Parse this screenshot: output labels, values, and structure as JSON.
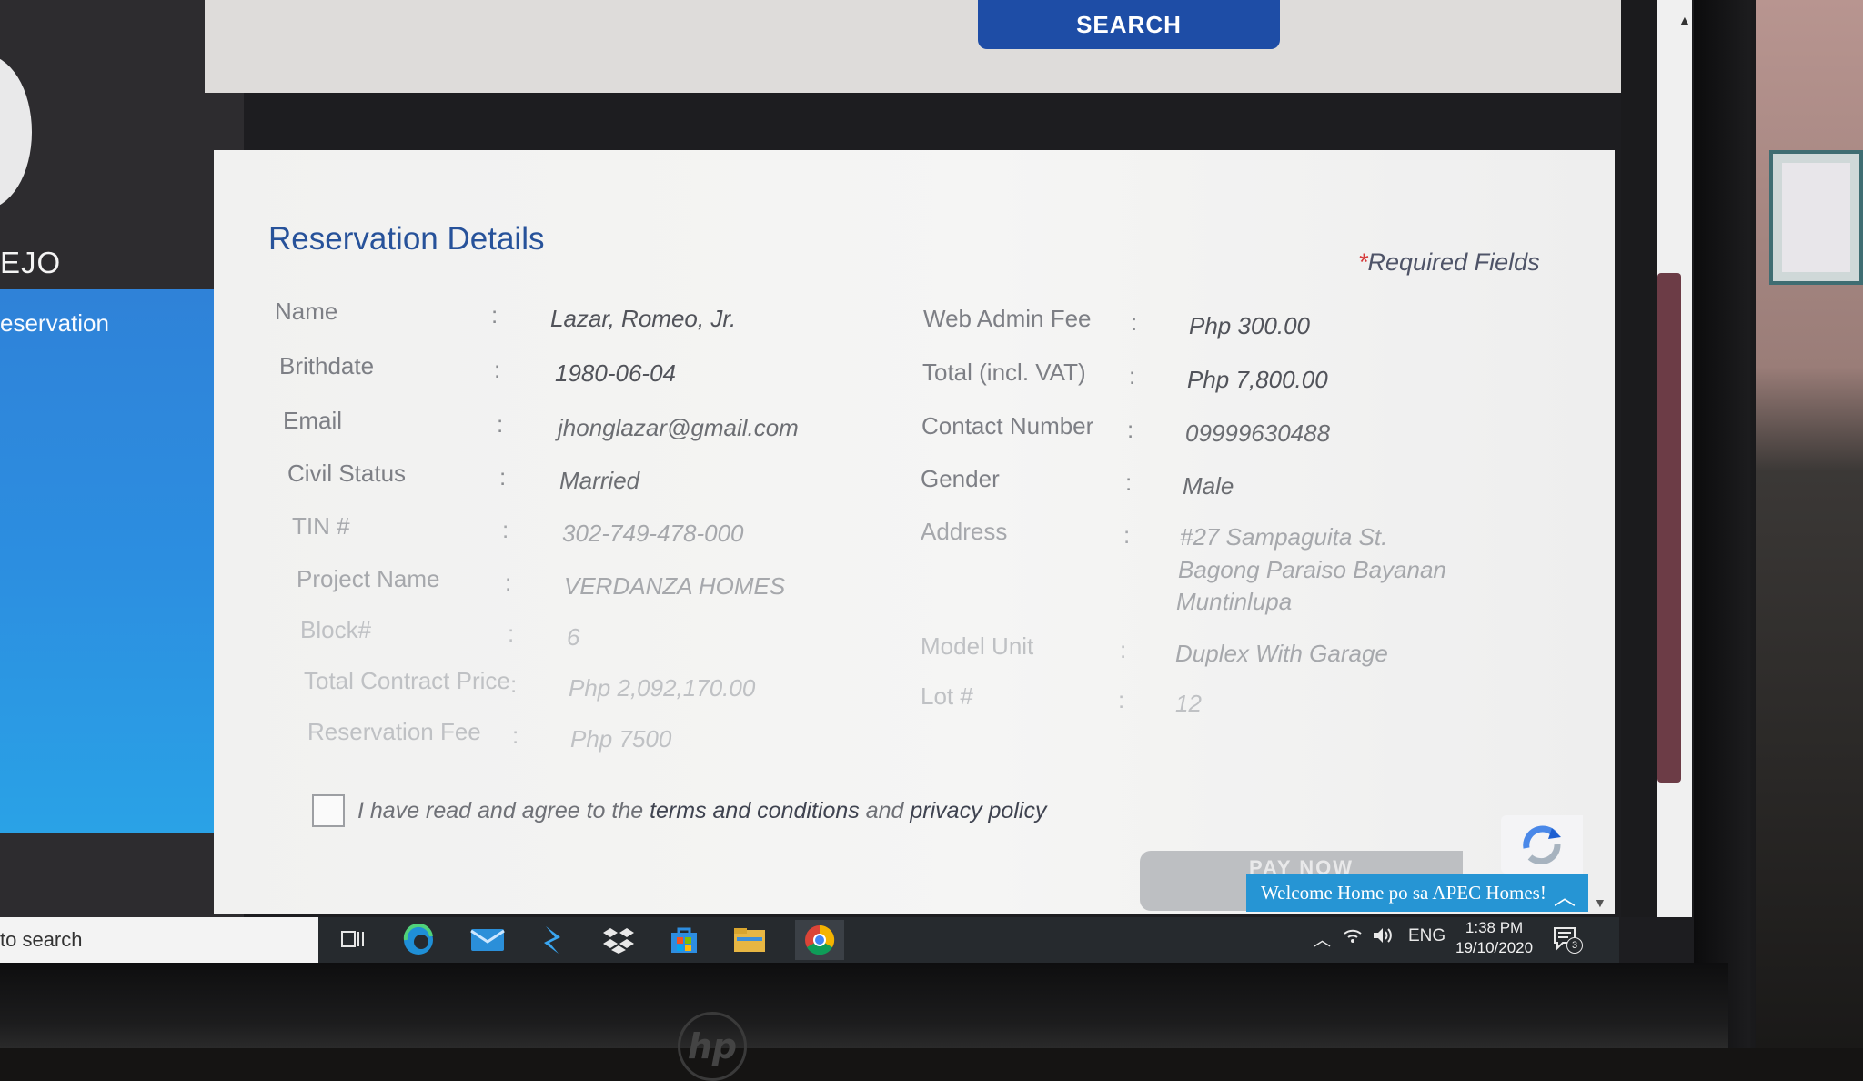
{
  "sidebar": {
    "user_name": "EJO",
    "nav_active_label": "eservation"
  },
  "header": {
    "search_label": "SEARCH"
  },
  "form": {
    "title": "Reservation Details",
    "required_star": "*",
    "required_text": "Required Fields",
    "left_fields": [
      {
        "label": "Name",
        "value": "Lazar, Romeo, Jr."
      },
      {
        "label": "Brithdate",
        "value": "1980-06-04"
      },
      {
        "label": "Email",
        "value": "jhonglazar@gmail.com"
      },
      {
        "label": "Civil Status",
        "value": "Married"
      },
      {
        "label": "TIN #",
        "value": "302-749-478-000"
      },
      {
        "label": "Project Name",
        "value": "VERDANZA HOMES"
      },
      {
        "label": "Block#",
        "value": "6"
      },
      {
        "label": "Total Contract Price",
        "value": "Php 2,092,170.00"
      },
      {
        "label": "Reservation Fee",
        "value": "Php 7500"
      }
    ],
    "right_fields": [
      {
        "label": "Web Admin Fee",
        "value": "Php 300.00"
      },
      {
        "label": "Total (incl. VAT)",
        "value": "Php 7,800.00"
      },
      {
        "label": "Contact Number",
        "value": "09999630488"
      },
      {
        "label": "Gender",
        "value": "Male"
      },
      {
        "label": "Address",
        "value_lines": [
          "#27 Sampaguita St.",
          "Bagong Paraiso Bayanan",
          "Muntinlupa"
        ]
      },
      {
        "label": "Model Unit",
        "value": "Duplex With Garage"
      },
      {
        "label": "Lot #",
        "value": "12"
      }
    ],
    "colon": ":",
    "agree": {
      "prefix": "I have read and agree to the",
      "terms_link": "terms and conditions",
      "middle": "and",
      "privacy_link": "privacy policy"
    },
    "pay_button": "PAY NOW"
  },
  "chat_widget": {
    "text": "Welcome Home po sa APEC Homes!"
  },
  "taskbar": {
    "search_text": "to search",
    "icons": [
      "task-view-icon",
      "edge-icon",
      "mail-icon",
      "visual-studio-icon",
      "dropbox-icon",
      "store-icon",
      "file-explorer-icon",
      "chrome-icon"
    ],
    "language": "ENG",
    "time": "1:38 PM",
    "date": "19/10/2020",
    "notification_count": "3"
  },
  "colors": {
    "primary_blue": "#1e4da6",
    "title_blue": "#27529a",
    "sidebar_blue": "#2c8ee0",
    "chat_blue": "#2695d4",
    "taskbar": "#262a2e"
  }
}
